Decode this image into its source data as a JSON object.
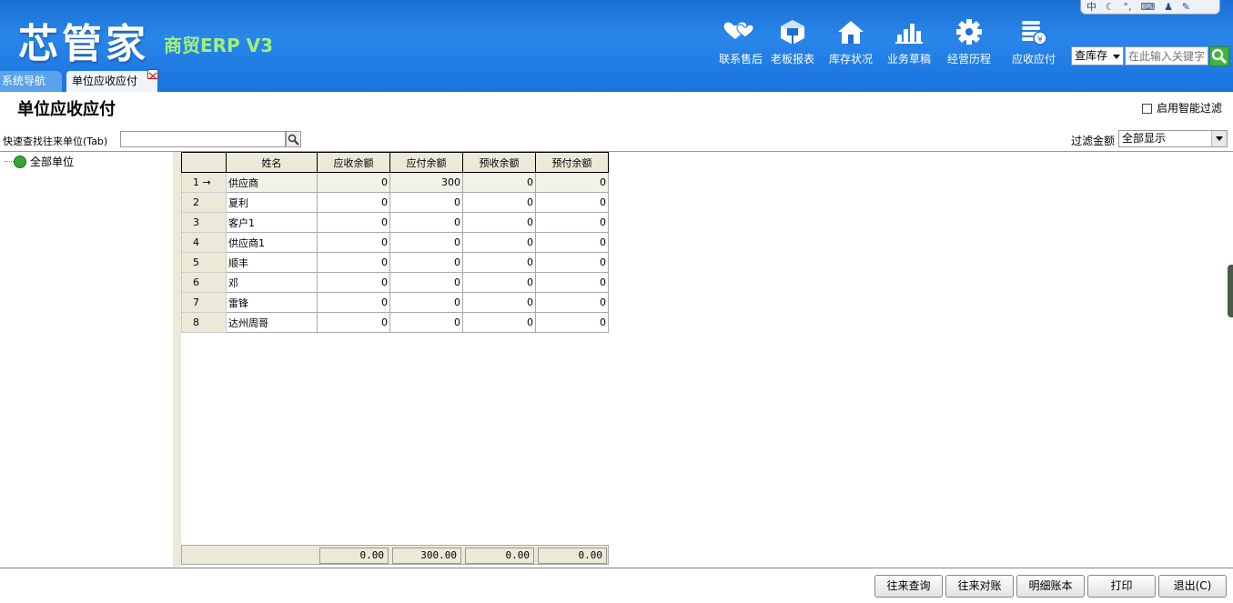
{
  "header": {
    "logo": "芯管家",
    "product": "商贸ERP V3",
    "nav": [
      {
        "label": "联系售后",
        "icon": "heart-icon"
      },
      {
        "label": "老板报表",
        "icon": "cube-icon"
      },
      {
        "label": "库存状况",
        "icon": "house-icon"
      },
      {
        "label": "业务草稿",
        "icon": "bar-chart-icon"
      },
      {
        "label": "经营历程",
        "icon": "gear-icon"
      },
      {
        "label": "应收应付",
        "icon": "coin-stack-icon"
      }
    ],
    "search_select": "查库存",
    "search_placeholder": "在此输入关键字",
    "ime": "中"
  },
  "tabs": {
    "nav": "系统导航",
    "active": "单位应收应付"
  },
  "page": {
    "title": "单位应收应付",
    "smart_filter": "启用智能过滤",
    "quick_label": "快速查找往来单位(Tab)",
    "amount_filter_label": "过滤金额",
    "amount_filter_value": "全部显示"
  },
  "tree": {
    "root": "全部单位"
  },
  "table": {
    "columns": [
      "姓名",
      "应收余额",
      "应付余额",
      "预收余额",
      "预付余额"
    ],
    "rows": [
      {
        "no": "1 →",
        "name": "供应商",
        "ar": "0",
        "ap": "300",
        "pr": "0",
        "pp": "0"
      },
      {
        "no": "2",
        "name": "夏利",
        "ar": "0",
        "ap": "0",
        "pr": "0",
        "pp": "0"
      },
      {
        "no": "3",
        "name": "客户1",
        "ar": "0",
        "ap": "0",
        "pr": "0",
        "pp": "0"
      },
      {
        "no": "4",
        "name": "供应商1",
        "ar": "0",
        "ap": "0",
        "pr": "0",
        "pp": "0"
      },
      {
        "no": "5",
        "name": "顺丰",
        "ar": "0",
        "ap": "0",
        "pr": "0",
        "pp": "0"
      },
      {
        "no": "6",
        "name": "邓",
        "ar": "0",
        "ap": "0",
        "pr": "0",
        "pp": "0"
      },
      {
        "no": "7",
        "name": "雷锋",
        "ar": "0",
        "ap": "0",
        "pr": "0",
        "pp": "0"
      },
      {
        "no": "8",
        "name": "达州周哥",
        "ar": "0",
        "ap": "0",
        "pr": "0",
        "pp": "0"
      }
    ],
    "totals": {
      "ar": "0.00",
      "ap": "300.00",
      "pr": "0.00",
      "pp": "0.00"
    }
  },
  "buttons": {
    "query": "往来查询",
    "reconcile": "往来对账",
    "ledger": "明细账本",
    "print": "打印",
    "exit": "退出(C)"
  },
  "colors": {
    "header_blue": "#1a6fd4",
    "accent_green": "#9ff27a",
    "grid_header": "#ece9d8"
  }
}
